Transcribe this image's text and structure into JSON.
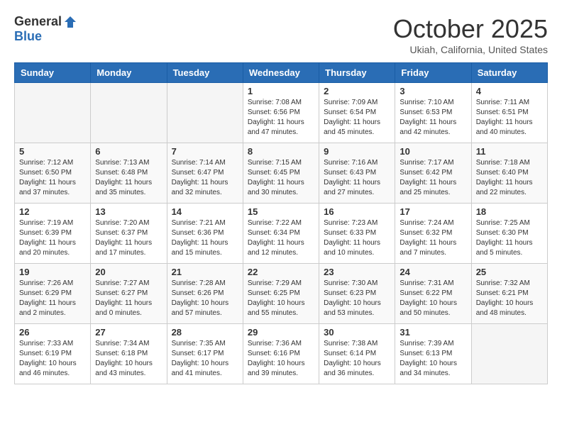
{
  "logo": {
    "general": "General",
    "blue": "Blue"
  },
  "title": "October 2025",
  "location": "Ukiah, California, United States",
  "days_of_week": [
    "Sunday",
    "Monday",
    "Tuesday",
    "Wednesday",
    "Thursday",
    "Friday",
    "Saturday"
  ],
  "weeks": [
    [
      {
        "day": "",
        "info": ""
      },
      {
        "day": "",
        "info": ""
      },
      {
        "day": "",
        "info": ""
      },
      {
        "day": "1",
        "info": "Sunrise: 7:08 AM\nSunset: 6:56 PM\nDaylight: 11 hours\nand 47 minutes."
      },
      {
        "day": "2",
        "info": "Sunrise: 7:09 AM\nSunset: 6:54 PM\nDaylight: 11 hours\nand 45 minutes."
      },
      {
        "day": "3",
        "info": "Sunrise: 7:10 AM\nSunset: 6:53 PM\nDaylight: 11 hours\nand 42 minutes."
      },
      {
        "day": "4",
        "info": "Sunrise: 7:11 AM\nSunset: 6:51 PM\nDaylight: 11 hours\nand 40 minutes."
      }
    ],
    [
      {
        "day": "5",
        "info": "Sunrise: 7:12 AM\nSunset: 6:50 PM\nDaylight: 11 hours\nand 37 minutes."
      },
      {
        "day": "6",
        "info": "Sunrise: 7:13 AM\nSunset: 6:48 PM\nDaylight: 11 hours\nand 35 minutes."
      },
      {
        "day": "7",
        "info": "Sunrise: 7:14 AM\nSunset: 6:47 PM\nDaylight: 11 hours\nand 32 minutes."
      },
      {
        "day": "8",
        "info": "Sunrise: 7:15 AM\nSunset: 6:45 PM\nDaylight: 11 hours\nand 30 minutes."
      },
      {
        "day": "9",
        "info": "Sunrise: 7:16 AM\nSunset: 6:43 PM\nDaylight: 11 hours\nand 27 minutes."
      },
      {
        "day": "10",
        "info": "Sunrise: 7:17 AM\nSunset: 6:42 PM\nDaylight: 11 hours\nand 25 minutes."
      },
      {
        "day": "11",
        "info": "Sunrise: 7:18 AM\nSunset: 6:40 PM\nDaylight: 11 hours\nand 22 minutes."
      }
    ],
    [
      {
        "day": "12",
        "info": "Sunrise: 7:19 AM\nSunset: 6:39 PM\nDaylight: 11 hours\nand 20 minutes."
      },
      {
        "day": "13",
        "info": "Sunrise: 7:20 AM\nSunset: 6:37 PM\nDaylight: 11 hours\nand 17 minutes."
      },
      {
        "day": "14",
        "info": "Sunrise: 7:21 AM\nSunset: 6:36 PM\nDaylight: 11 hours\nand 15 minutes."
      },
      {
        "day": "15",
        "info": "Sunrise: 7:22 AM\nSunset: 6:34 PM\nDaylight: 11 hours\nand 12 minutes."
      },
      {
        "day": "16",
        "info": "Sunrise: 7:23 AM\nSunset: 6:33 PM\nDaylight: 11 hours\nand 10 minutes."
      },
      {
        "day": "17",
        "info": "Sunrise: 7:24 AM\nSunset: 6:32 PM\nDaylight: 11 hours\nand 7 minutes."
      },
      {
        "day": "18",
        "info": "Sunrise: 7:25 AM\nSunset: 6:30 PM\nDaylight: 11 hours\nand 5 minutes."
      }
    ],
    [
      {
        "day": "19",
        "info": "Sunrise: 7:26 AM\nSunset: 6:29 PM\nDaylight: 11 hours\nand 2 minutes."
      },
      {
        "day": "20",
        "info": "Sunrise: 7:27 AM\nSunset: 6:27 PM\nDaylight: 11 hours\nand 0 minutes."
      },
      {
        "day": "21",
        "info": "Sunrise: 7:28 AM\nSunset: 6:26 PM\nDaylight: 10 hours\nand 57 minutes."
      },
      {
        "day": "22",
        "info": "Sunrise: 7:29 AM\nSunset: 6:25 PM\nDaylight: 10 hours\nand 55 minutes."
      },
      {
        "day": "23",
        "info": "Sunrise: 7:30 AM\nSunset: 6:23 PM\nDaylight: 10 hours\nand 53 minutes."
      },
      {
        "day": "24",
        "info": "Sunrise: 7:31 AM\nSunset: 6:22 PM\nDaylight: 10 hours\nand 50 minutes."
      },
      {
        "day": "25",
        "info": "Sunrise: 7:32 AM\nSunset: 6:21 PM\nDaylight: 10 hours\nand 48 minutes."
      }
    ],
    [
      {
        "day": "26",
        "info": "Sunrise: 7:33 AM\nSunset: 6:19 PM\nDaylight: 10 hours\nand 46 minutes."
      },
      {
        "day": "27",
        "info": "Sunrise: 7:34 AM\nSunset: 6:18 PM\nDaylight: 10 hours\nand 43 minutes."
      },
      {
        "day": "28",
        "info": "Sunrise: 7:35 AM\nSunset: 6:17 PM\nDaylight: 10 hours\nand 41 minutes."
      },
      {
        "day": "29",
        "info": "Sunrise: 7:36 AM\nSunset: 6:16 PM\nDaylight: 10 hours\nand 39 minutes."
      },
      {
        "day": "30",
        "info": "Sunrise: 7:38 AM\nSunset: 6:14 PM\nDaylight: 10 hours\nand 36 minutes."
      },
      {
        "day": "31",
        "info": "Sunrise: 7:39 AM\nSunset: 6:13 PM\nDaylight: 10 hours\nand 34 minutes."
      },
      {
        "day": "",
        "info": ""
      }
    ]
  ]
}
